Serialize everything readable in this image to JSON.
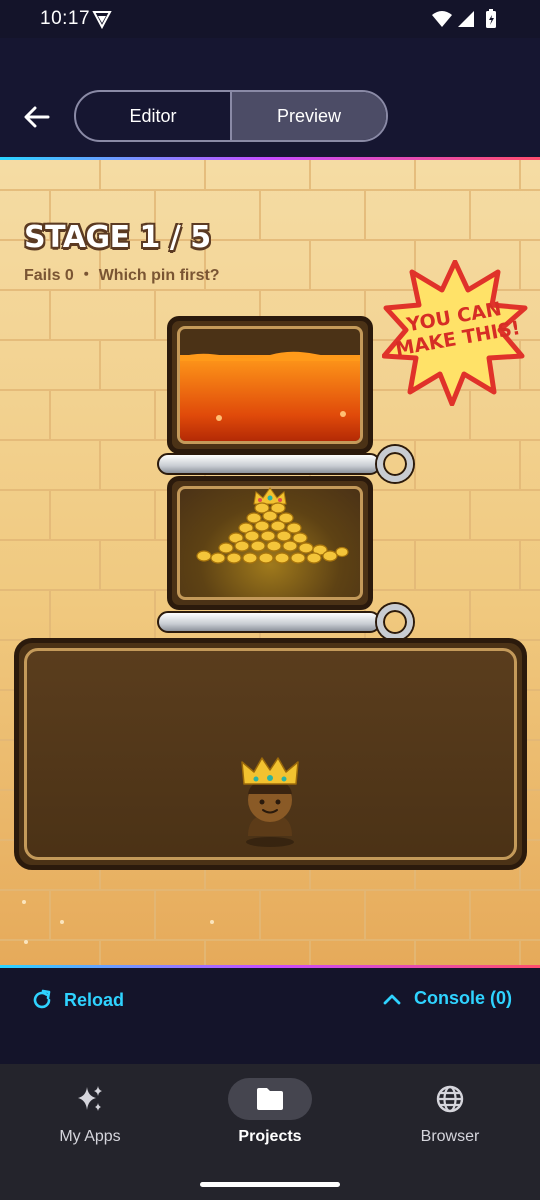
{
  "status": {
    "time": "10:17"
  },
  "header": {
    "tabs": [
      {
        "label": "Editor",
        "active": false
      },
      {
        "label": "Preview",
        "active": true
      }
    ]
  },
  "game": {
    "stage_title": "STAGE 1 / 5",
    "stage_sub": "Fails 0 ・ Which pin first?",
    "badge": {
      "line1": "YOU CAN",
      "line2": "MAKE THIS!"
    }
  },
  "console_bar": {
    "reload_label": "Reload",
    "console_label": "Console (0)"
  },
  "nav": {
    "items": [
      {
        "label": "My Apps",
        "icon": "sparkles-icon"
      },
      {
        "label": "Projects",
        "icon": "folder-icon"
      },
      {
        "label": "Browser",
        "icon": "globe-icon"
      }
    ]
  },
  "colors": {
    "accent": "#2fd3ff",
    "lava": "#e04a0a",
    "gold": "#f2c230",
    "tank": "#4b3216"
  }
}
